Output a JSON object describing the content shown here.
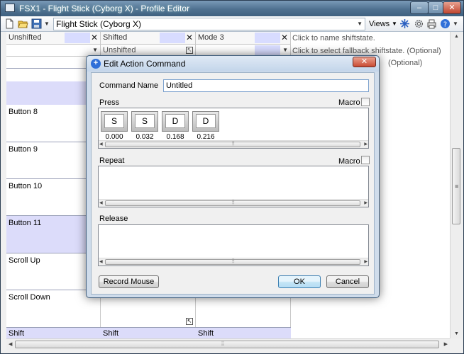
{
  "window": {
    "title": "FSX1 - Flight Stick (Cyborg X) - Profile Editor",
    "minimize": "–",
    "maximize": "□",
    "close": "✕"
  },
  "toolbar": {
    "profile": "Flight Stick (Cyborg X)",
    "views": "Views",
    "icons": [
      "new-file-icon",
      "open-folder-icon",
      "save-icon",
      "settings-icon",
      "print-icon",
      "help-icon"
    ]
  },
  "grid": {
    "headers": [
      "Unshifted",
      "Shifted",
      "Mode 3"
    ],
    "header_note": "Click to name shiftstate.",
    "fallback_values": [
      "",
      "Unshifted",
      ""
    ],
    "fallback_note": "Click to select fallback shiftstate. (Optional)",
    "third_note": "(Optional)",
    "rows": [
      {
        "name": "Button 8"
      },
      {
        "name": "Button 9"
      },
      {
        "name": "Button 10"
      },
      {
        "name": "Button 11"
      },
      {
        "name": "Scroll Up"
      },
      {
        "name": "Scroll Down"
      }
    ],
    "footer": [
      "Shift",
      "Shift",
      "Shift"
    ]
  },
  "dialog": {
    "title": "Edit Action Command",
    "close": "✕",
    "command_name_label": "Command Name",
    "command_name_value": "Untitled",
    "press_label": "Press",
    "repeat_label": "Repeat",
    "release_label": "Release",
    "macro_label": "Macro",
    "press_macro_checked": false,
    "repeat_macro_checked": false,
    "keys": [
      {
        "key": "S",
        "time": "0.000"
      },
      {
        "key": "S",
        "time": "0.032"
      },
      {
        "key": "D",
        "time": "0.168"
      },
      {
        "key": "D",
        "time": "0.216"
      }
    ],
    "record_mouse": "Record Mouse",
    "ok": "OK",
    "cancel": "Cancel"
  },
  "colors": {
    "row_highlight": "#dcdcfa",
    "header_highlight": "#d8dcff",
    "default_button": "#c4e5f6"
  }
}
